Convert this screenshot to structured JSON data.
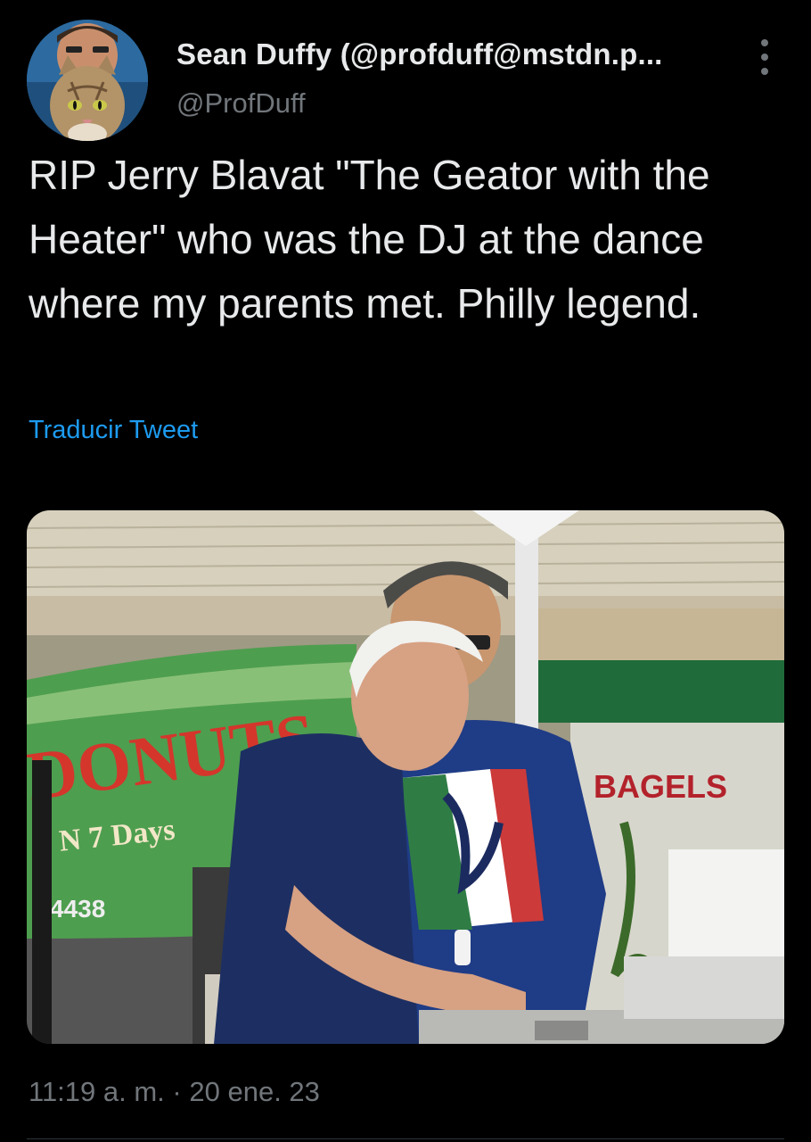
{
  "author": {
    "display_name": "Sean Duffy (@profduff@mstdn.p...",
    "handle": "@ProfDuff"
  },
  "tweet": {
    "text": "RIP Jerry Blavat \"The Geator with the Heater\" who was the DJ at the dance where my parents met. Philly legend.",
    "translate_label": "Traducir Tweet",
    "time": "11:19 a. m.",
    "separator": "·",
    "date": "20 ene. 23"
  },
  "photo": {
    "sign_donuts": "DONUTS",
    "sign_days": "N 7 Days",
    "sign_phone": "4438",
    "sign_bagels": "BAGELS"
  },
  "icons": {
    "more": "more-vertical-icon"
  },
  "colors": {
    "background": "#000000",
    "text": "#e7e9ea",
    "secondary": "#71767b",
    "link": "#1d9bf0"
  }
}
